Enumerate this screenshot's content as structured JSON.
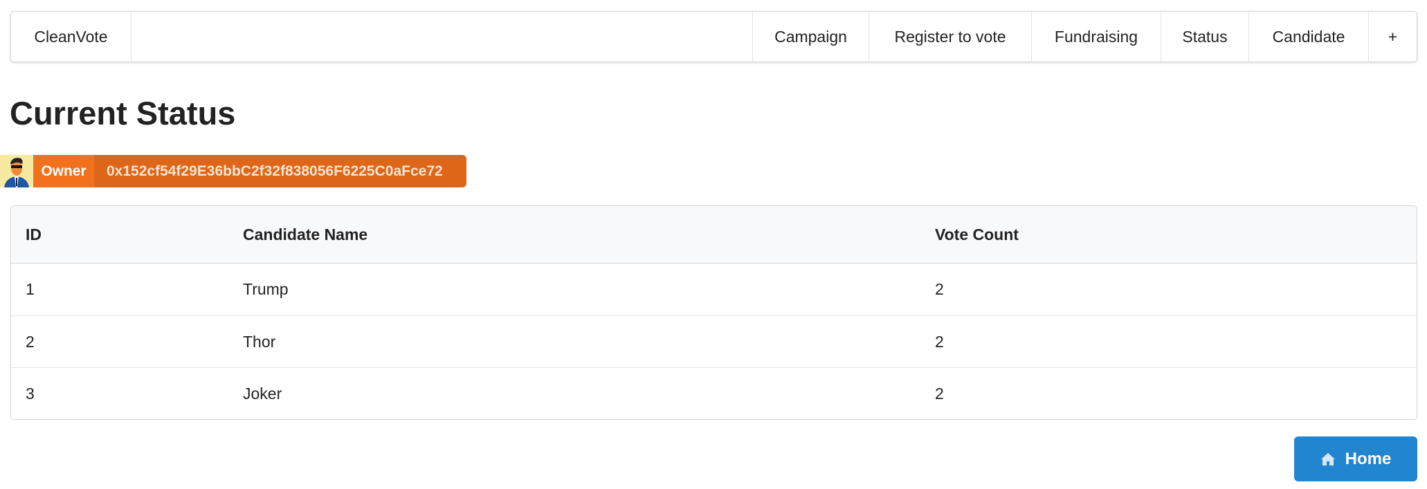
{
  "nav": {
    "brand": "CleanVote",
    "items": [
      "Campaign",
      "Register to vote",
      "Fundraising",
      "Status",
      "Candidate",
      "+"
    ]
  },
  "page_title": "Current Status",
  "owner": {
    "label": "Owner",
    "address": "0x152cf54f29E36bbC2f32f838056F6225C0aFce72"
  },
  "table": {
    "headers": [
      "ID",
      "Candidate Name",
      "Vote Count"
    ],
    "rows": [
      [
        "1",
        "Trump",
        "2"
      ],
      [
        "2",
        "Thor",
        "2"
      ],
      [
        "3",
        "Joker",
        "2"
      ]
    ]
  },
  "home_button": {
    "label": "Home",
    "icon": "home-icon"
  },
  "colors": {
    "owner": "#f2711c",
    "address": "#dd6618",
    "primary": "#2185d0"
  }
}
